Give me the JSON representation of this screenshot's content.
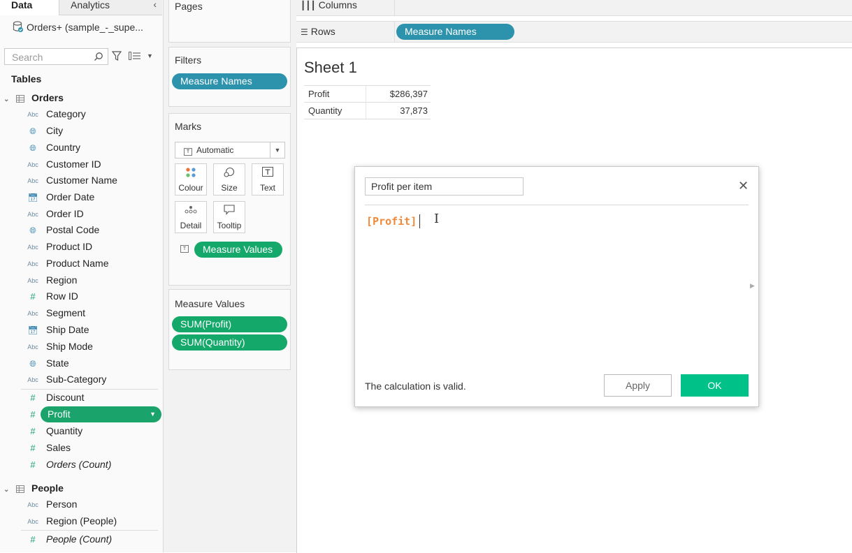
{
  "colors": {
    "accent_green": "#14a86a",
    "accent_blue": "#2d93ad",
    "ok_button": "#00c288",
    "formula_orange": "#f08a3a"
  },
  "tabs": {
    "data": "Data",
    "analytics": "Analytics",
    "collapse_icon": "chevron-left"
  },
  "datasource": {
    "name": "Orders+ (sample_-_supe...",
    "icon": "database-icon"
  },
  "search": {
    "placeholder": "Search"
  },
  "tables_heading": "Tables",
  "orders_table": {
    "name": "Orders",
    "dimensions": [
      {
        "label": "Category",
        "icon": "Abc"
      },
      {
        "label": "City",
        "icon": "globe"
      },
      {
        "label": "Country",
        "icon": "globe"
      },
      {
        "label": "Customer ID",
        "icon": "Abc"
      },
      {
        "label": "Customer Name",
        "icon": "Abc"
      },
      {
        "label": "Order Date",
        "icon": "calendar"
      },
      {
        "label": "Order ID",
        "icon": "Abc"
      },
      {
        "label": "Postal Code",
        "icon": "globe"
      },
      {
        "label": "Product ID",
        "icon": "Abc"
      },
      {
        "label": "Product Name",
        "icon": "Abc"
      },
      {
        "label": "Region",
        "icon": "Abc"
      },
      {
        "label": "Row ID",
        "icon": "#"
      },
      {
        "label": "Segment",
        "icon": "Abc"
      },
      {
        "label": "Ship Date",
        "icon": "calendar"
      },
      {
        "label": "Ship Mode",
        "icon": "Abc"
      },
      {
        "label": "State",
        "icon": "globe"
      },
      {
        "label": "Sub-Category",
        "icon": "Abc"
      }
    ],
    "measures": [
      {
        "label": "Discount",
        "icon": "#"
      },
      {
        "label": "Profit",
        "icon": "#",
        "selected": true
      },
      {
        "label": "Quantity",
        "icon": "#"
      },
      {
        "label": "Sales",
        "icon": "#"
      },
      {
        "label": "Orders (Count)",
        "icon": "#"
      }
    ]
  },
  "people_table": {
    "name": "People",
    "dimensions": [
      {
        "label": "Person",
        "icon": "Abc"
      },
      {
        "label": "Region (People)",
        "icon": "Abc"
      }
    ],
    "measures": [
      {
        "label": "People (Count)",
        "icon": "#"
      }
    ]
  },
  "pages": {
    "title": "Pages"
  },
  "filters": {
    "title": "Filters",
    "pills": [
      "Measure Names"
    ]
  },
  "marks": {
    "title": "Marks",
    "type": "Automatic",
    "buttons": {
      "colour": "Colour",
      "size": "Size",
      "text": "Text",
      "detail": "Detail",
      "tooltip": "Tooltip"
    },
    "text_pill": "Measure Values"
  },
  "measure_values": {
    "title": "Measure Values",
    "pills": [
      "SUM(Profit)",
      "SUM(Quantity)"
    ]
  },
  "shelves": {
    "columns": "Columns",
    "rows": "Rows",
    "rows_pill": "Measure Names"
  },
  "sheet": {
    "title": "Sheet 1",
    "rows": [
      {
        "name": "Profit",
        "value": "$286,397"
      },
      {
        "name": "Quantity",
        "value": "37,873"
      }
    ]
  },
  "calc_dialog": {
    "name": "Profit per item",
    "formula": "[Profit]",
    "status": "The calculation is valid.",
    "apply": "Apply",
    "ok": "OK"
  }
}
